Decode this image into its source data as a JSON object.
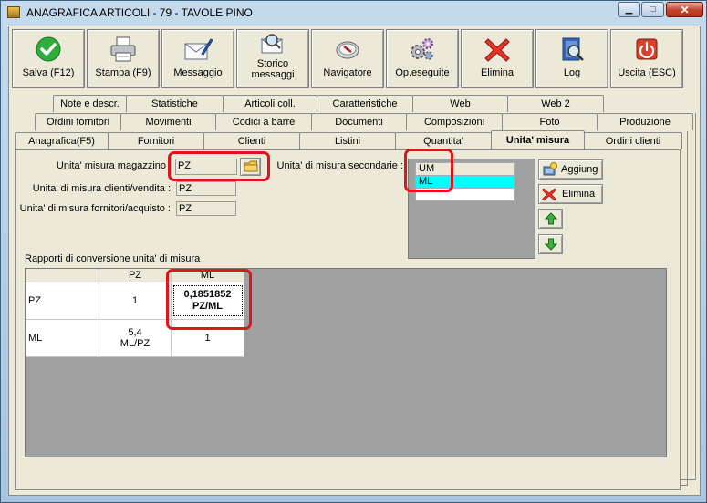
{
  "window": {
    "title": "ANAGRAFICA ARTICOLI - 79 - TAVOLE PINO",
    "controls": {
      "minimize": "▁",
      "maximize": "□",
      "close": "✕"
    }
  },
  "toolbar": [
    {
      "id": "salva",
      "label": "Salva (F12)",
      "icon": "check-icon"
    },
    {
      "id": "stampa",
      "label": "Stampa (F9)",
      "icon": "printer-icon"
    },
    {
      "id": "messaggio",
      "label": "Messaggio",
      "icon": "envelope-pen-icon"
    },
    {
      "id": "storico",
      "label": "Storico messaggi",
      "icon": "envelope-search-icon"
    },
    {
      "id": "navigatore",
      "label": "Navigatore",
      "icon": "compass-icon"
    },
    {
      "id": "opeseguite",
      "label": "Op.eseguite",
      "icon": "gears-icon"
    },
    {
      "id": "elimina",
      "label": "Elimina",
      "icon": "red-x-icon"
    },
    {
      "id": "log",
      "label": "Log",
      "icon": "book-search-icon"
    },
    {
      "id": "uscita",
      "label": "Uscita (ESC)",
      "icon": "exit-icon"
    }
  ],
  "tabs": {
    "row1": [
      "Note e descr.",
      "Statistiche",
      "Articoli coll.",
      "Caratteristiche",
      "Web",
      "Web 2"
    ],
    "row2": [
      "Ordini fornitori",
      "Movimenti",
      "Codici a barre",
      "Documenti",
      "Composizioni",
      "Foto",
      "Produzione"
    ],
    "row3": [
      "Anagrafica(F5)",
      "Fornitori",
      "Clienti",
      "Listini",
      "Quantita'",
      "Unita' misura",
      "Ordini clienti"
    ],
    "active": "Unita' misura"
  },
  "form": {
    "magazzino_label": "Unita' misura magazzino",
    "magazzino_value": "PZ",
    "clienti_label": "Unita' di misura clienti/vendita :",
    "clienti_value": "PZ",
    "fornitori_label": "Unita' di misura fornitori/acquisto :",
    "fornitori_value": "PZ",
    "secondarie_label": "Unita' di misura secondarie :"
  },
  "secondary_list": {
    "header": "UM",
    "rows": [
      "ML"
    ],
    "selected": "ML",
    "selected_color": "#00ffff"
  },
  "side_buttons": {
    "aggiungi": "Aggiung",
    "elimina": "Elimina"
  },
  "conversion": {
    "title": "Rapporti di conversione unita' di misura",
    "columns": [
      "PZ",
      "ML"
    ],
    "rows": [
      {
        "label": "PZ",
        "cells": [
          "1",
          "0,1851852\nPZ/ML"
        ]
      },
      {
        "label": "ML",
        "cells": [
          "5,4\nML/PZ",
          "1"
        ]
      }
    ]
  },
  "colors": {
    "highlight": "#e0141a",
    "face": "#ece9d8"
  }
}
